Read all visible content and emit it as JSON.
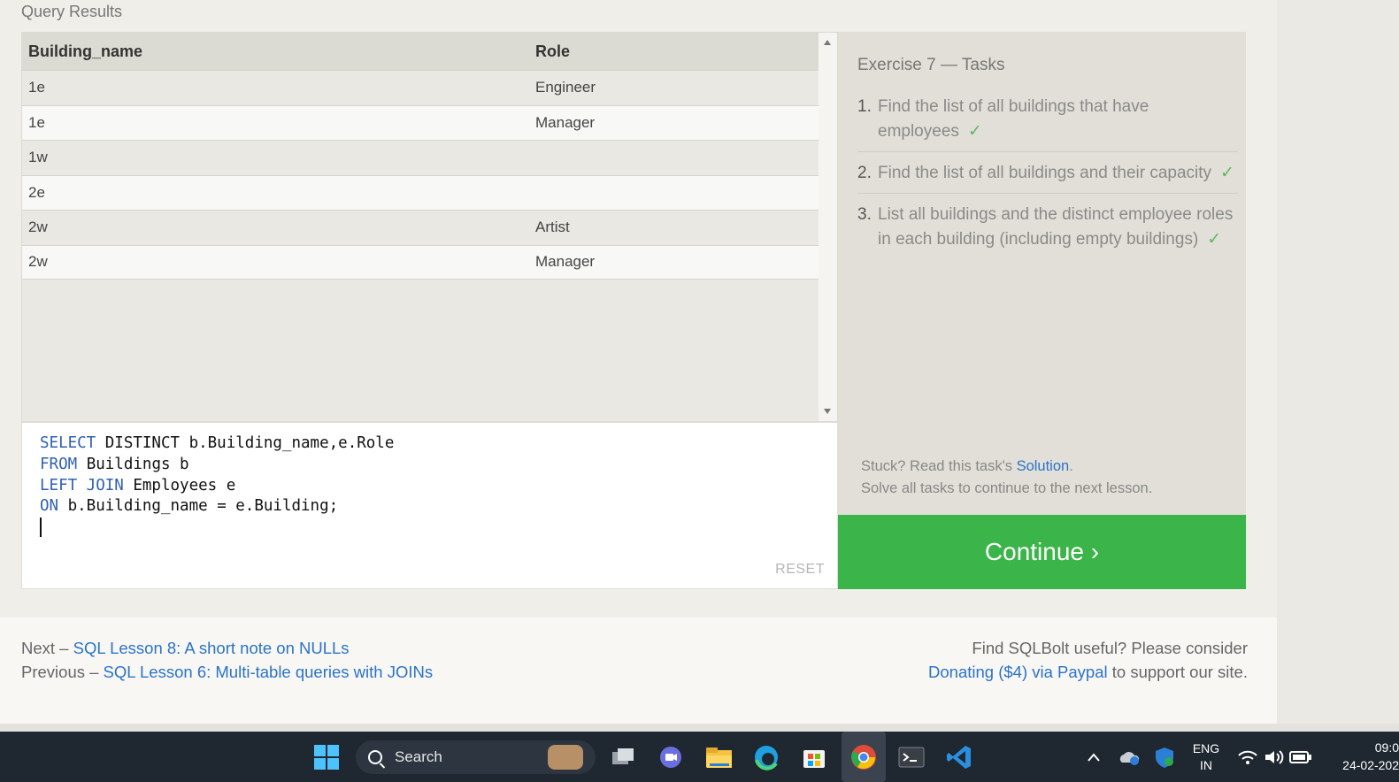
{
  "results": {
    "title": "Query Results",
    "columns": [
      "Building_name",
      "Role"
    ],
    "rows": [
      [
        "1e",
        "Engineer"
      ],
      [
        "1e",
        "Manager"
      ],
      [
        "1w",
        ""
      ],
      [
        "2e",
        ""
      ],
      [
        "2w",
        "Artist"
      ],
      [
        "2w",
        "Manager"
      ]
    ]
  },
  "editor": {
    "lines": [
      {
        "kw": "SELECT",
        "rest": " DISTINCT b.Building_name,e.Role"
      },
      {
        "kw": "FROM",
        "rest": " Buildings b"
      },
      {
        "kw": "LEFT JOIN",
        "rest": " Employees e"
      },
      {
        "kw": "ON",
        "rest": " b.Building_name = e.Building;"
      }
    ],
    "reset_label": "RESET"
  },
  "tasks": {
    "title": "Exercise 7 — Tasks",
    "items": [
      {
        "num": "1.",
        "text": "Find the list of all buildings that have employees",
        "check": "✓"
      },
      {
        "num": "2.",
        "text": "Find the list of all buildings and their capacity",
        "check": "✓"
      },
      {
        "num": "3.",
        "text": "List all buildings and the distinct employee roles in each building (including empty buildings)",
        "check": "✓"
      }
    ],
    "stuck_prefix": "Stuck? Read this task's ",
    "solution_link": "Solution",
    "stuck_suffix": ".",
    "solve_all": "Solve all tasks to continue to the next lesson."
  },
  "continue_label": "Continue ›",
  "footer": {
    "next_prefix": "Next – ",
    "next_link": "SQL Lesson 8: A short note on NULLs",
    "prev_prefix": "Previous – ",
    "prev_link": "SQL Lesson 6: Multi-table queries with JOINs",
    "useful": "Find SQLBolt useful? Please consider",
    "donate_link": "Donating ($4) via Paypal",
    "donate_suffix": " to support our site."
  },
  "taskbar": {
    "search_label": "Search",
    "lang_top": "ENG",
    "lang_bottom": "IN",
    "time": "09:0",
    "date": "24-02-202"
  },
  "colors": {
    "accent_green": "#3bb449",
    "link_blue": "#2b73c9",
    "keyword_blue": "#2f5fb5"
  }
}
